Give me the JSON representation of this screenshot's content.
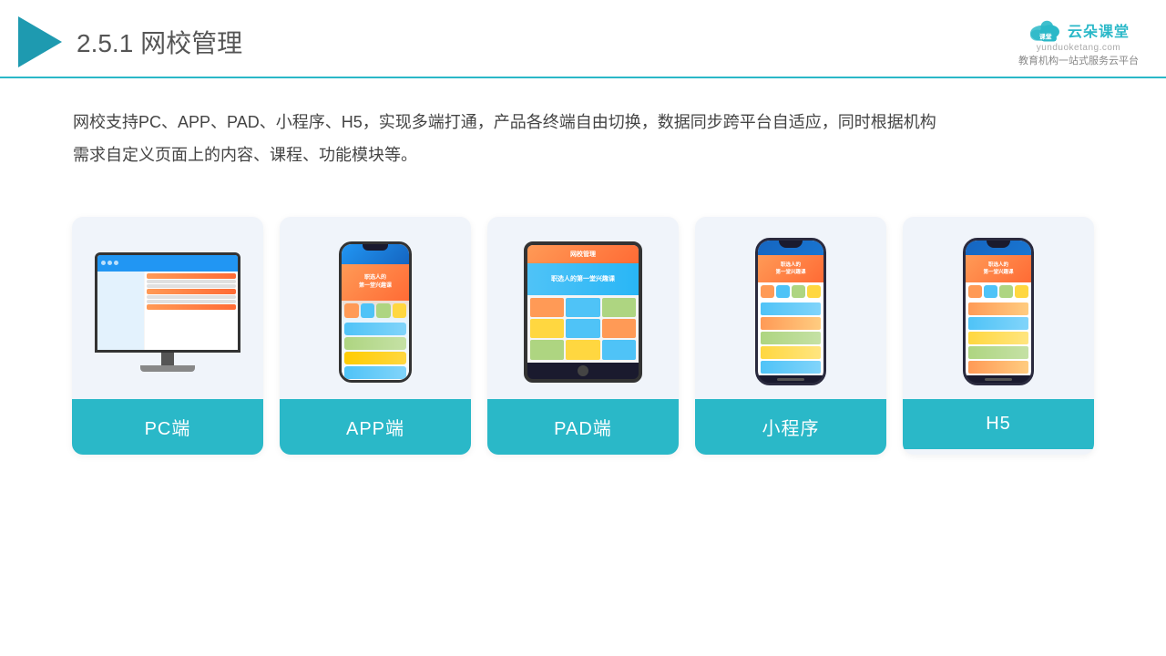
{
  "header": {
    "title_number": "2.5.1",
    "title_text": "网校管理",
    "brand_name": "云朵课堂",
    "brand_url": "yunduoketang.com",
    "brand_slogan": "教育机构一站\n式服务云平台"
  },
  "description": {
    "text": "网校支持PC、APP、PAD、小程序、H5，实现多端打通，产品各终端自由切换，数据同步跨平台自适应，同时根据机构\n需求自定义页面上的内容、课程、功能模块等。"
  },
  "cards": [
    {
      "id": "pc",
      "label": "PC端"
    },
    {
      "id": "app",
      "label": "APP端"
    },
    {
      "id": "pad",
      "label": "PAD端"
    },
    {
      "id": "miniprogram",
      "label": "小程序"
    },
    {
      "id": "h5",
      "label": "H5"
    }
  ],
  "colors": {
    "accent": "#2ab8c8",
    "header_border": "#2ab8c8",
    "triangle": "#1e9ab0",
    "card_bg": "#f0f4fa",
    "card_label_bg": "#2ab8c8"
  }
}
